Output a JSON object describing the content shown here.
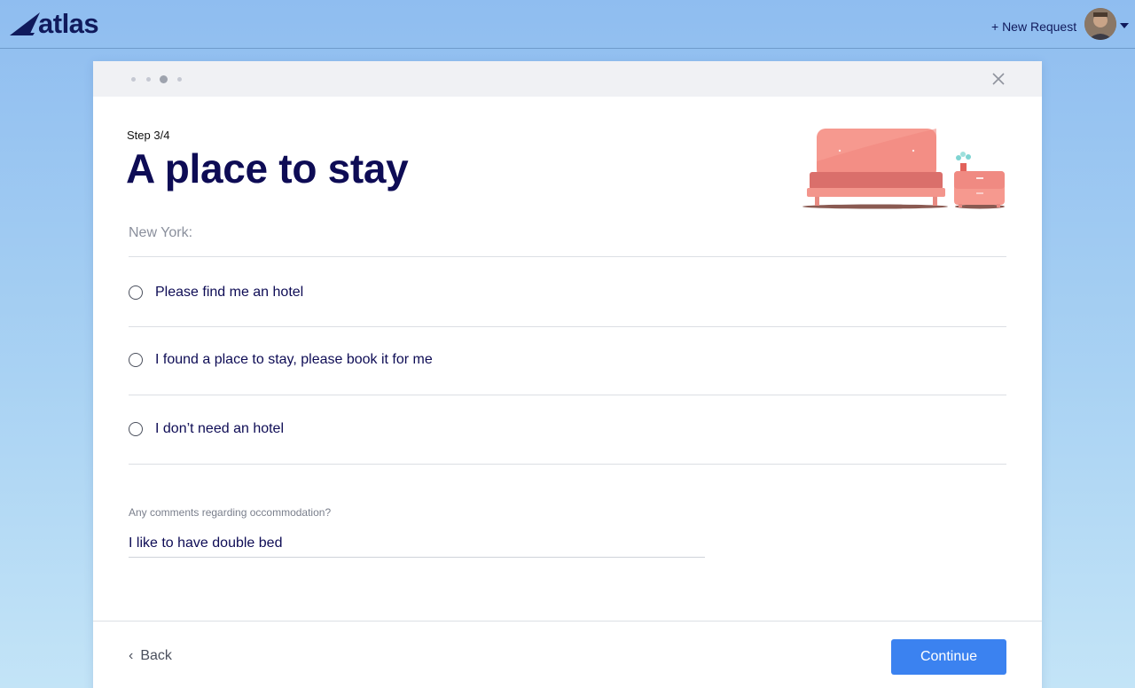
{
  "app": {
    "logo_text": "atlas",
    "new_request_label": "+ New Request"
  },
  "modal": {
    "progress": {
      "total_steps": 4,
      "current_step": 3
    },
    "step_label": "Step 3/4",
    "title": "A place to stay",
    "city_label": "New York:",
    "options": [
      {
        "label": "Please find me an hotel",
        "selected": false
      },
      {
        "label": "I found a place to stay, please book it for me",
        "selected": false
      },
      {
        "label": "I don’t need an hotel",
        "selected": false
      }
    ],
    "comment": {
      "label": "Any comments regarding occommodation?",
      "value": "I like to have double bed"
    },
    "back_label": "Back",
    "continue_label": "Continue"
  },
  "colors": {
    "brand_navy": "#0e0c55",
    "primary_button": "#3b82f0",
    "sofa": "#f08a82"
  }
}
